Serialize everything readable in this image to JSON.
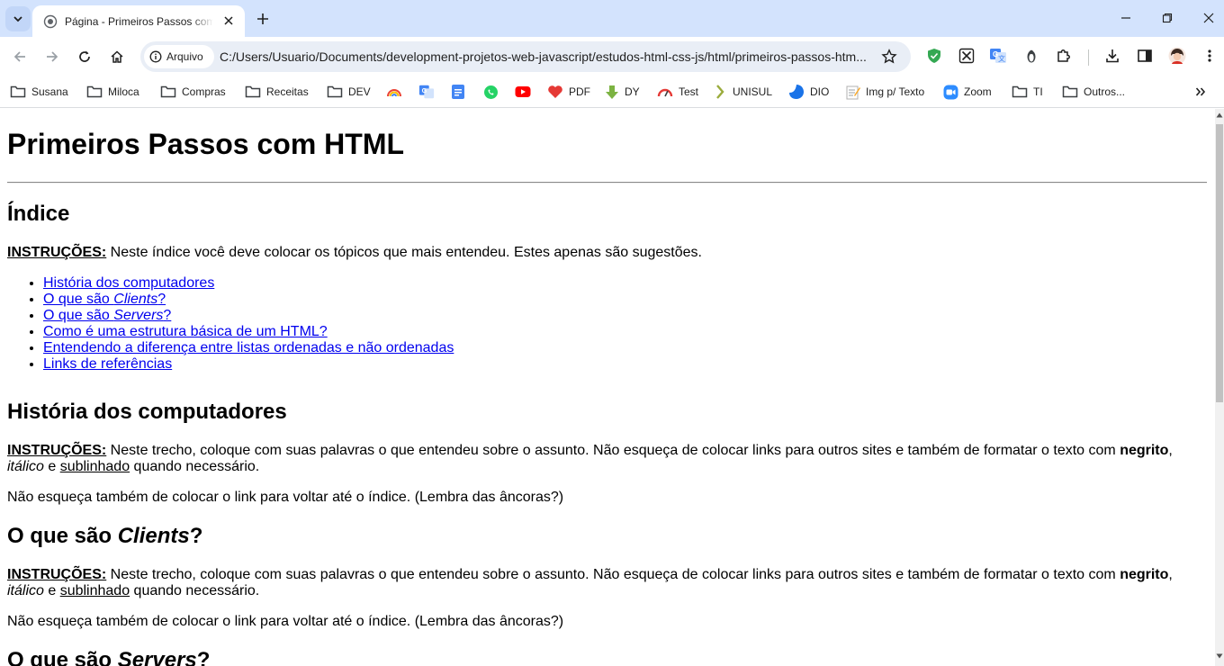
{
  "browser": {
    "tab": {
      "title": "Página - Primeiros Passos com HTML"
    },
    "address_bar": {
      "security_chip": "Arquivo",
      "url": "C:/Users/Usuario/Documents/development-projetos-web-javascript/estudos-html-css-js/html/primeiros-passos-htm..."
    },
    "bookmarks": [
      {
        "label": "Susana",
        "icon": "folder-icon"
      },
      {
        "label": "Miloca",
        "icon": "folder-icon"
      },
      {
        "label": "Compras",
        "icon": "folder-icon"
      },
      {
        "label": "Receitas",
        "icon": "folder-icon"
      },
      {
        "label": "DEV",
        "icon": "folder-icon"
      },
      {
        "label": "",
        "icon": "rainbow-icon"
      },
      {
        "label": "",
        "icon": "google-translate-icon"
      },
      {
        "label": "",
        "icon": "google-docs-icon"
      },
      {
        "label": "",
        "icon": "whatsapp-icon"
      },
      {
        "label": "",
        "icon": "youtube-icon"
      },
      {
        "label": "PDF",
        "icon": "pdf-heart-icon"
      },
      {
        "label": "DY",
        "icon": "download-arrow-icon"
      },
      {
        "label": "Test",
        "icon": "speedometer-icon"
      },
      {
        "label": "UNISUL",
        "icon": "unisul-icon"
      },
      {
        "label": "DIO",
        "icon": "dio-icon"
      },
      {
        "label": "Img p/ Texto",
        "icon": "memo-icon"
      },
      {
        "label": "Zoom",
        "icon": "zoom-icon"
      },
      {
        "label": "TI",
        "icon": "folder-icon"
      },
      {
        "label": "Outros...",
        "icon": "folder-icon"
      }
    ]
  },
  "page": {
    "title": "Primeiros Passos com HTML",
    "index": {
      "heading": "Índice",
      "instr_label": "INSTRUÇÕES:",
      "instr_text": " Neste índice você deve colocar os tópicos que mais entendeu. Estes apenas são sugestões.",
      "links": {
        "historia": "História dos computadores",
        "clients_pre": "O que são ",
        "clients_em": "Clients",
        "clients_post": "?",
        "servers_pre": "O que são ",
        "servers_em": "Servers",
        "servers_post": "?",
        "estrutura": "Como é uma estrutura básica de um HTML?",
        "listas": "Entendendo a diferença entre listas ordenadas e não ordenadas",
        "referencias": "Links de referências"
      }
    },
    "sections": {
      "historia": {
        "heading": "História dos computadores"
      },
      "clients": {
        "heading_pre": "O que são ",
        "heading_em": "Clients",
        "heading_post": "?"
      },
      "servers": {
        "heading_pre": "O que são ",
        "heading_em": "Servers",
        "heading_post": "?"
      }
    },
    "section_instr": {
      "label": "INSTRUÇÕES:",
      "text": " Neste trecho, coloque com suas palavras o que entendeu sobre o assunto. Não esqueça de colocar links para outros sites e também de formatar o texto com ",
      "bold": "negrito",
      "comma": ",",
      "italic": "itálico",
      "e": " e ",
      "underline": "sublinhado",
      "tail": " quando necessário.",
      "reminder": "Não esqueça também de colocar o link para voltar até o índice. (Lembra das âncoras?)"
    }
  },
  "colors": {
    "tabstrip": "#d3e3fd",
    "omnibox": "#e9eef6",
    "link": "#0000ee"
  }
}
